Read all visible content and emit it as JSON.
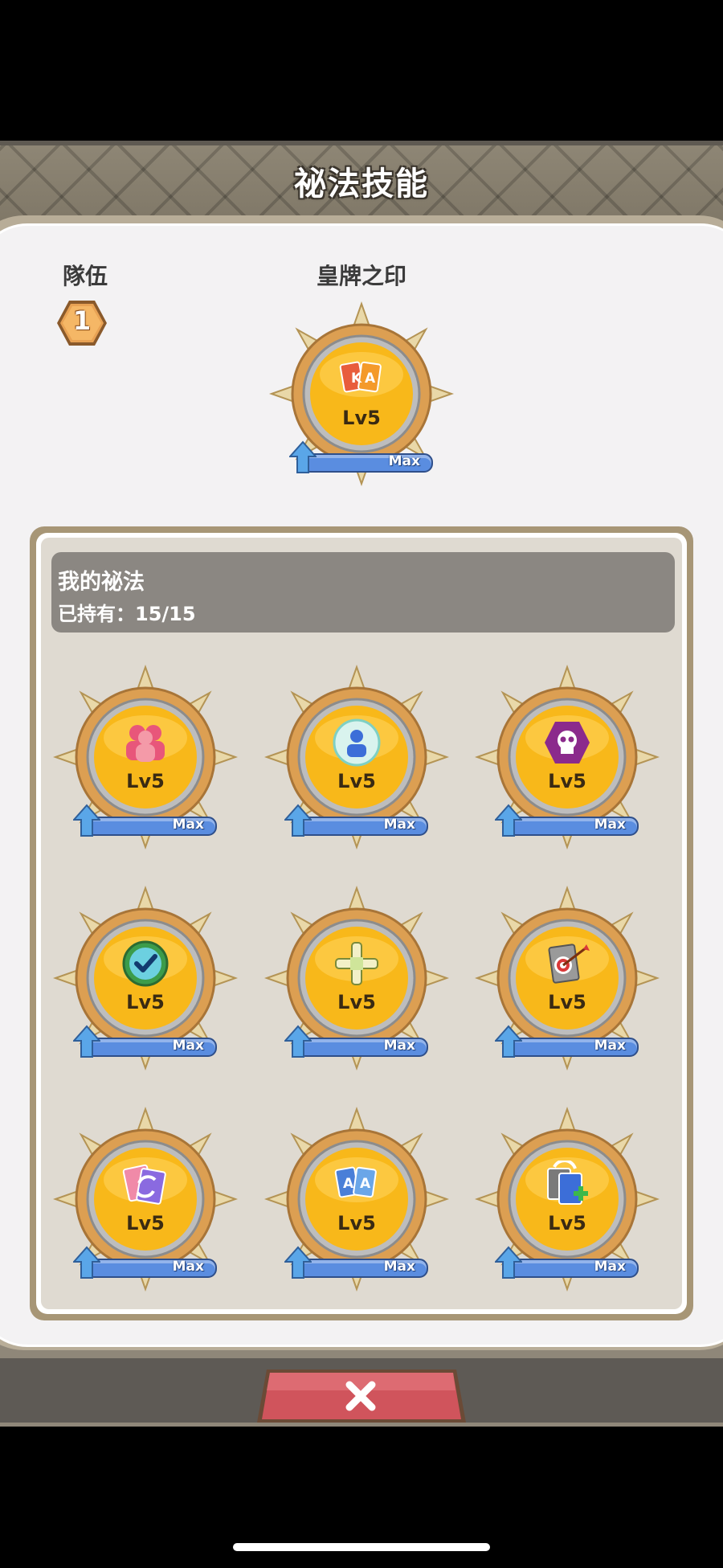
{
  "title": "祕法技能",
  "team": {
    "label": "隊伍",
    "number": "1"
  },
  "main_skill": {
    "name": "皇牌之印",
    "level": "Lv5",
    "max_label": "Max",
    "icon": "ka-cards-icon"
  },
  "inventory": {
    "title": "我的祕法",
    "owned": "已持有：15/15",
    "skills": [
      {
        "icon": "group-icon",
        "level": "Lv5",
        "max_label": "Max"
      },
      {
        "icon": "single-person-icon",
        "level": "Lv5",
        "max_label": "Max"
      },
      {
        "icon": "skull-hexagon-icon",
        "level": "Lv5",
        "max_label": "Max"
      },
      {
        "icon": "checkmark-circle-icon",
        "level": "Lv5",
        "max_label": "Max"
      },
      {
        "icon": "cross-connector-icon",
        "level": "Lv5",
        "max_label": "Max"
      },
      {
        "icon": "target-card-icon",
        "level": "Lv5",
        "max_label": "Max"
      },
      {
        "icon": "swap-cards-icon",
        "level": "Lv5",
        "max_label": "Max"
      },
      {
        "icon": "aa-cards-icon",
        "level": "Lv5",
        "max_label": "Max"
      },
      {
        "icon": "add-card-icon",
        "level": "Lv5",
        "max_label": "Max"
      }
    ]
  },
  "close_label": "✕"
}
